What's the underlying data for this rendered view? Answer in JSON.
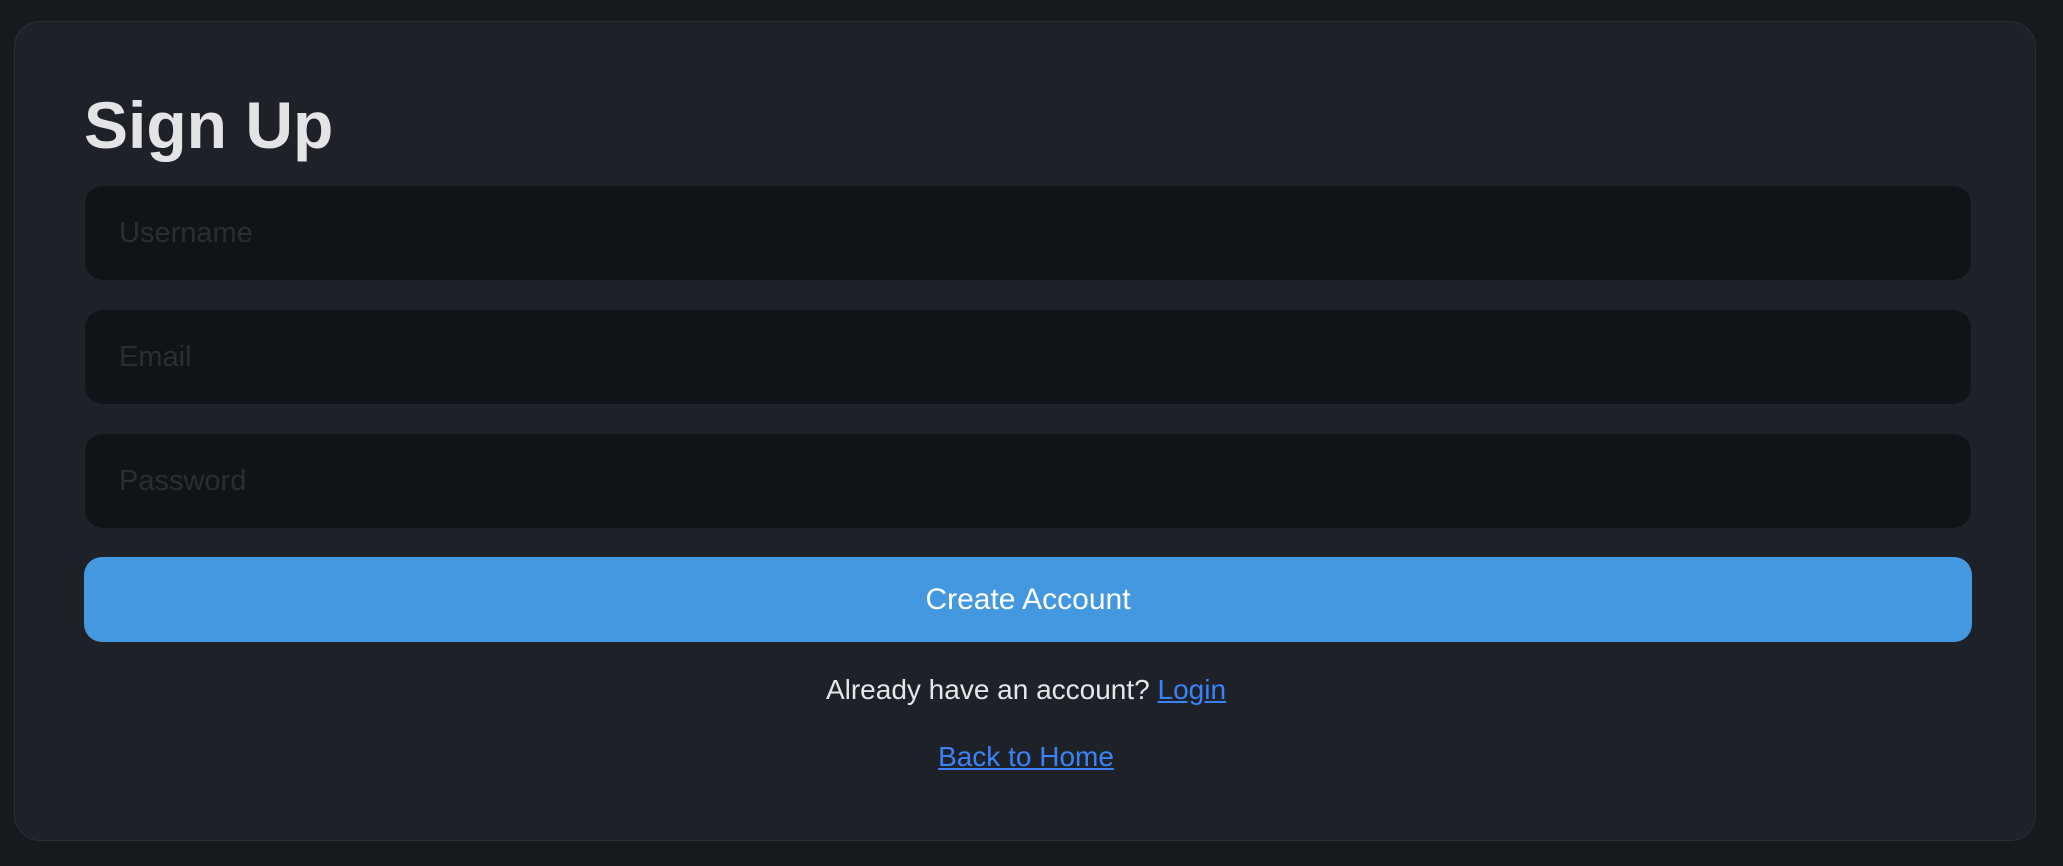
{
  "page": {
    "title": "Sign Up"
  },
  "form": {
    "username": {
      "placeholder": "Username",
      "value": ""
    },
    "email": {
      "placeholder": "Email",
      "value": ""
    },
    "password": {
      "placeholder": "Password",
      "value": ""
    },
    "submit_label": "Create Account"
  },
  "footer": {
    "login_prompt": "Already have an account?",
    "login_link": "Login",
    "home_link": "Back to Home"
  },
  "colors": {
    "background": "#18191d",
    "card": "#1f2129",
    "input": "#121317",
    "accent": "#4498e0",
    "link": "#3b82f6"
  }
}
